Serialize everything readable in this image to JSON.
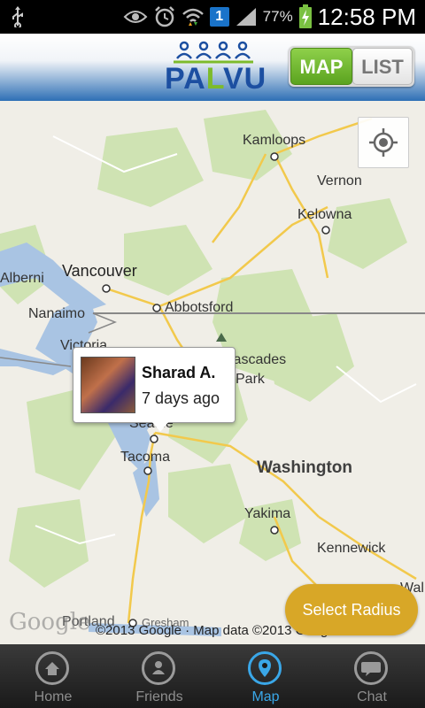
{
  "status_bar": {
    "time": "12:58 PM",
    "battery_percent": "77%",
    "notification_count": "1",
    "icons": [
      "usb-icon",
      "eye-icon",
      "alarm-icon",
      "wifi-icon",
      "signal-icon",
      "battery-charging-icon"
    ]
  },
  "header": {
    "logo_text_prefix": "PA",
    "logo_text_l": "L",
    "logo_text_suffix": "VU",
    "toggle": {
      "map_label": "MAP",
      "list_label": "LIST",
      "selected": "MAP"
    },
    "accent_green": "#7dbb2c",
    "brand_blue": "#1c4fa1"
  },
  "map": {
    "places": {
      "kamloops": "Kamloops",
      "vernon": "Vernon",
      "kelowna": "Kelowna",
      "vancouver": "Vancouver",
      "abbotsford": "Abbotsford",
      "nanaimo": "Nanaimo",
      "alberni": "Alberni",
      "victoria": "Victoria",
      "cascades": "Cascades",
      "park": "Park",
      "seattle": "Seattle",
      "tacoma": "Tacoma",
      "washington": "Washington",
      "yakima": "Yakima",
      "kennewick": "Kennewick",
      "portland": "Portland",
      "gresham": "Gresham",
      "walla": "Walla"
    },
    "google_logo": "Google",
    "attribution": "©2013 Google · Map data ©2013 Google",
    "select_radius_label": "Select Radius",
    "radius_button_color": "#d8a727"
  },
  "popup": {
    "name": "Sharad A.",
    "last_seen": "7 days ago"
  },
  "bottom_nav": {
    "active_color": "#3aa7e8",
    "items": [
      {
        "label": "Home",
        "icon": "home-icon"
      },
      {
        "label": "Friends",
        "icon": "friends-icon"
      },
      {
        "label": "Map",
        "icon": "map-pin-icon",
        "active": true
      },
      {
        "label": "Chat",
        "icon": "chat-icon"
      }
    ]
  }
}
